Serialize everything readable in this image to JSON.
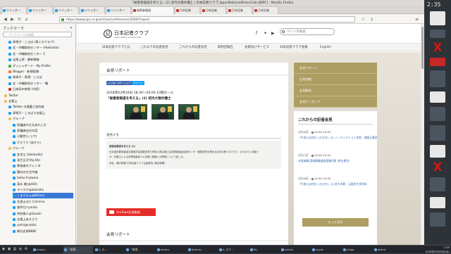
{
  "window": {
    "title": "「被害者報道を考える」(2) 武内大徳弁護士 | 日本記者クラブ JapanNationalPressClub (JNPC) - Mozilla Firefox"
  },
  "tabs": [
    {
      "label": "ツイッター",
      "icon": "twitter"
    },
    {
      "label": "ツイッター",
      "icon": "twitter"
    },
    {
      "label": "ツイッター",
      "icon": "twitter"
    },
    {
      "label": "ツイッター",
      "icon": "twitter"
    },
    {
      "label": "ツイッター",
      "icon": "twitter"
    },
    {
      "label": "被害者報道",
      "icon": "jnpc",
      "active": true
    },
    {
      "label": "日本記者",
      "icon": "jnpc"
    },
    {
      "label": "日本記者",
      "icon": "jnpc"
    },
    {
      "label": "日本記者",
      "icon": "jnpc"
    },
    {
      "label": "日本記者",
      "icon": "jnpc"
    }
  ],
  "urlbar": {
    "url": "https://www.jnpc.or.jp/archive/conferences/35067/report"
  },
  "sidebar": {
    "title": "ブックマーク",
    "search_placeholder": "ブックマークを検索",
    "items": [
      {
        "label": "車椅子・ころば (車いすクラブ)",
        "icon": "twitter",
        "indent": 1
      },
      {
        "label": "北・沖縄取材センター (Hokkaido)",
        "icon": "twitter",
        "indent": 1
      },
      {
        "label": "北・沖縄取材センター 2",
        "icon": "twitter",
        "indent": 1
      },
      {
        "label": "足尾上原 - 最新情報",
        "icon": "twitter",
        "indent": 1
      },
      {
        "label": "ダッシュボード - My Profile",
        "icon": "ok",
        "indent": 1
      },
      {
        "label": "Blogger - 新規投稿",
        "icon": "blogger",
        "indent": 1
      },
      {
        "label": "車椅子・表現 - ころば",
        "icon": "twitter",
        "indent": 1
      },
      {
        "label": "北・沖縄取材センター - 鶴",
        "icon": "twitter",
        "indent": 1
      },
      {
        "label": "日本初の病院 (大阪)",
        "icon": "jnpc",
        "indent": 1
      },
      {
        "label": "Twitter",
        "icon": "folder",
        "indent": 0
      },
      {
        "label": "支援上",
        "icon": "folder",
        "indent": 0
      },
      {
        "label": "Twitter の連載と批判者",
        "icon": "twitter",
        "indent": 1
      },
      {
        "label": "車椅子・ころばり支援上",
        "icon": "twitter",
        "indent": 1
      },
      {
        "label": "グループ",
        "icon": "folder",
        "indent": 1
      },
      {
        "label": "保護者の主なあれこれ",
        "icon": "twitter",
        "indent": 2
      },
      {
        "label": "保護者自分の話",
        "icon": "twitter",
        "indent": 2
      },
      {
        "label": "小動性(ショウ)",
        "icon": "twitter",
        "indent": 2
      },
      {
        "label": "そだてり (あかり)",
        "icon": "twitter",
        "indent": 2
      },
      {
        "label": "グループ",
        "icon": "folder",
        "indent": 1
      },
      {
        "label": "女木工 (Hokkaido)",
        "icon": "twitter",
        "indent": 2
      },
      {
        "label": "長生日子(Yoj-Ok)",
        "icon": "twitter",
        "indent": 2
      },
      {
        "label": "教育者のフレンダ",
        "icon": "twitter",
        "indent": 2
      },
      {
        "label": "関向の生活中継",
        "icon": "twitter",
        "indent": 2
      },
      {
        "label": "Seiko-Fujiwara",
        "icon": "twitter",
        "indent": 2
      },
      {
        "label": "清水 美(@HiO)",
        "icon": "twitter",
        "indent": 2
      },
      {
        "label": "ライスけ@akasaka",
        "icon": "twitter",
        "indent": 2
      },
      {
        "label": "くまえもん@Bikkuri",
        "icon": "twitter",
        "indent": 2,
        "selected": true
      },
      {
        "label": "北島士はりりのmine",
        "icon": "twitter",
        "indent": 2
      },
      {
        "label": "福井(ひろみ)ko",
        "icon": "twitter",
        "indent": 2
      },
      {
        "label": "利府美人@Suzuki",
        "icon": "twitter",
        "indent": 2
      },
      {
        "label": "支援上あきさり",
        "icon": "twitter",
        "indent": 2
      },
      {
        "label": "yoshi@nakko",
        "icon": "twitter",
        "indent": 2
      },
      {
        "label": "郷谷史郎BBBC",
        "icon": "twitter",
        "indent": 2
      }
    ]
  },
  "site": {
    "logo_mark": "記",
    "logo_name": "日本記者クラブ",
    "logo_sub": "Japan National Press Club",
    "search_placeholder": "サイト内検索",
    "nav": [
      "日本記者クラブとは",
      "これまでの記者会見",
      "これからの記者会見",
      "取材団報告",
      "会員向けサービス",
      "日本記者クラブ会報",
      "English"
    ]
  },
  "article": {
    "section_title": "会見リポート",
    "like_label": "いいね! 100",
    "share_label": "シェア",
    "tweet_label": "ツイート",
    "date": "2018年03月26日 18:30～20:00 10階ホール",
    "title": "「被害者報道を考える」(2) 武内大徳弁護士",
    "memo_heading": "会見メモ",
    "memo_lines": [
      "被害者報道を考える (2)",
      "日弁連犯罪被害者支援委員会副委員長で神奈川県弁護士会犯罪被害者支援センター副委員長を務める武内大徳 (たけうち・ひろのり) 弁護士",
      "が、弁護士による犯罪被害者への支援と報道との関係について話した。",
      "司会　瀬口和義 日本記者クラブ企画委員 (東京新聞)"
    ],
    "youtube_label": "YouTube会見動画",
    "report_title": "会見リポート"
  },
  "right_menu": [
    "会見リポート",
    "会見詳細",
    "会見動画",
    "会見アーカイブ"
  ],
  "upcoming": {
    "heading": "これからの記者会見",
    "events": [
      {
        "date": "5月16日",
        "time": "14:00-15:30",
        "title": "「平成とは何だったのか」(3) ノンフィクション作家・保阪正康氏"
      },
      {
        "date": "5月17日",
        "time": "14:00-15:30",
        "title": "水俣病事 園遊事業組成理報代表 (除五郎生)"
      },
      {
        "date": "5月18日",
        "time": "14:00-15:30",
        "title": "「平成とは何だったのか」(2) 佐々木毅・元東京大学学長"
      }
    ],
    "more_label": "もっと見る"
  },
  "taskbar": {
    "items": [
      "emacs",
      "「被害...",
      "e_ス...",
      "「被害...",
      "emacs",
      "iphona...",
      "e_スク...",
      "ttc",
      "xclock",
      "xeyes",
      "xlogo",
      "xterm"
    ],
    "clock": "2:35",
    "date": "2018年05月16日(水)"
  },
  "desktop": {
    "clock": "2:35"
  }
}
